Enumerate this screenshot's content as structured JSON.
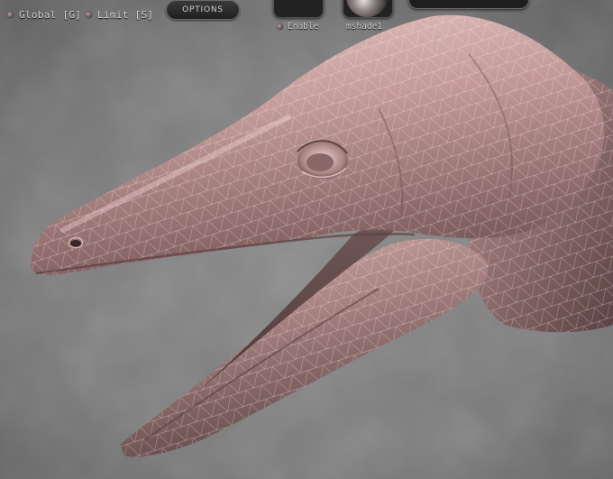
{
  "toolbar": {
    "global_label": "Global [G]",
    "limit_label": "Limit [S]",
    "options_label": "OPTIONS",
    "enable_label": "Enable",
    "material_label": "mshade1"
  },
  "colors": {
    "background": "#7a7a7a",
    "model_skin": "#c8a4a4",
    "wireframe": "#f2e6e6",
    "toolbar_dark": "#1e1e1e"
  },
  "icons": {
    "radio": "radio-dot",
    "material_preview": "sphere-matcap"
  }
}
